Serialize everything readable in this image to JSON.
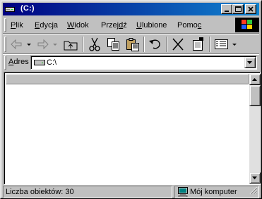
{
  "window": {
    "title": "(C:)",
    "title_icon": "drive-icon",
    "colors": {
      "titlebar_start": "#000080",
      "titlebar_end": "#1084d0",
      "face": "#c0c0c0"
    }
  },
  "menu": [
    {
      "label_u": "P",
      "label_rest": "lik"
    },
    {
      "label_u": "E",
      "label_rest": "dycja"
    },
    {
      "label_u": "W",
      "label_rest": "idok"
    },
    {
      "label_pre": "Przej",
      "label_u": "d",
      "label_rest": "ź"
    },
    {
      "label_u": "U",
      "label_rest": "lubione"
    },
    {
      "label_pre": "Pomo",
      "label_u": "c",
      "label_rest": ""
    }
  ],
  "toolbar": {
    "buttons": [
      "back-icon",
      "forward-icon",
      "up-folder-icon",
      "cut-icon",
      "copy-icon",
      "paste-icon",
      "undo-icon",
      "delete-icon",
      "properties-icon",
      "views-icon"
    ]
  },
  "address": {
    "label_u": "A",
    "label_rest": "dres",
    "value": "C:\\"
  },
  "status": {
    "object_count": "Liczba obiektów: 30",
    "zone": "Mój komputer"
  }
}
